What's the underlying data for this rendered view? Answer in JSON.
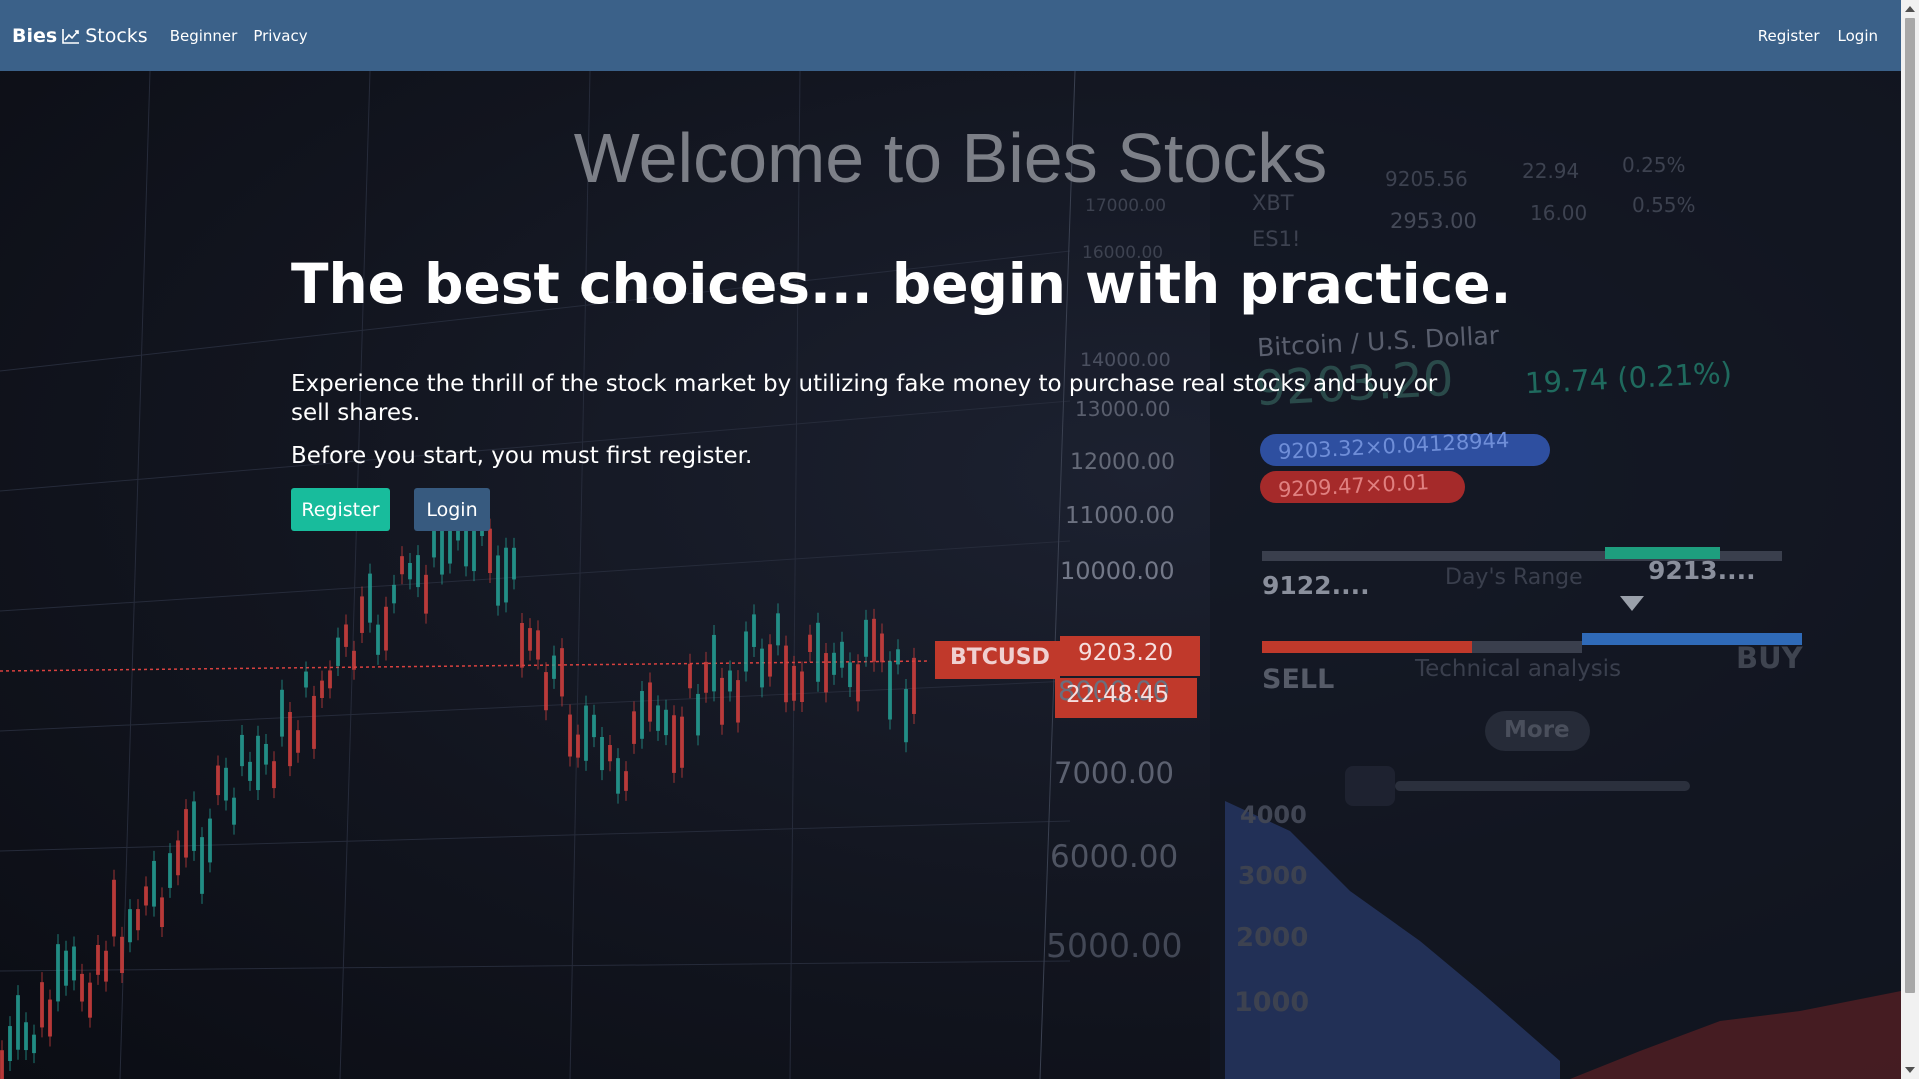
{
  "navbar": {
    "brand_part1": "Bies",
    "brand_icon": "chart-line-icon",
    "brand_part2": "Stocks",
    "links": [
      "Beginner",
      "Privacy"
    ],
    "right_links": [
      "Register",
      "Login"
    ]
  },
  "hero": {
    "welcome": "Welcome to Bies Stocks",
    "headline": "The best choices... begin with practice.",
    "description": "Experience the thrill of the stock market by utilizing fake money to purchase real stocks and buy or sell shares.",
    "prompt": "Before you start, you must first register.",
    "register_button": "Register",
    "login_button": "Login"
  },
  "background": {
    "price_axis": [
      "14000.00",
      "13000.00",
      "12000.00",
      "11000.00",
      "10000.00",
      "8000.00",
      "7000.00",
      "6000.00",
      "5000.00"
    ],
    "upper_axis": [
      "17000.00",
      "16000.00"
    ],
    "ticker_label": "BTCUSD",
    "ticker_price": "9203.20",
    "ticker_time": "22:48:45",
    "pair_title": "Bitcoin / U.S. Dollar",
    "pair_price": "9203.20",
    "pair_change": "19.74 (0.21%)",
    "bid": "9203.32×0.04128944",
    "ask": "9209.47×0.01",
    "range_low": "9122....",
    "range_label": "Day's Range",
    "range_high": "9213....",
    "sell_label": "SELL",
    "analysis_label": "Technical analysis",
    "buy_label": "BUY",
    "more_label": "More",
    "depth_axis": [
      "4000",
      "3000",
      "2000",
      "1000"
    ],
    "table_rows": [
      {
        "sym": "XBT",
        "price": "9205.56",
        "chg": "22.94",
        "pct": "0.25%"
      },
      {
        "sym": "ES1!",
        "price": "2953.00",
        "chg": "16.00",
        "pct": "0.55%"
      }
    ],
    "colors": {
      "up": "#26a69a",
      "down": "#d9413f"
    }
  },
  "scrollbar": {
    "thumb": "scrollbar-thumb"
  }
}
